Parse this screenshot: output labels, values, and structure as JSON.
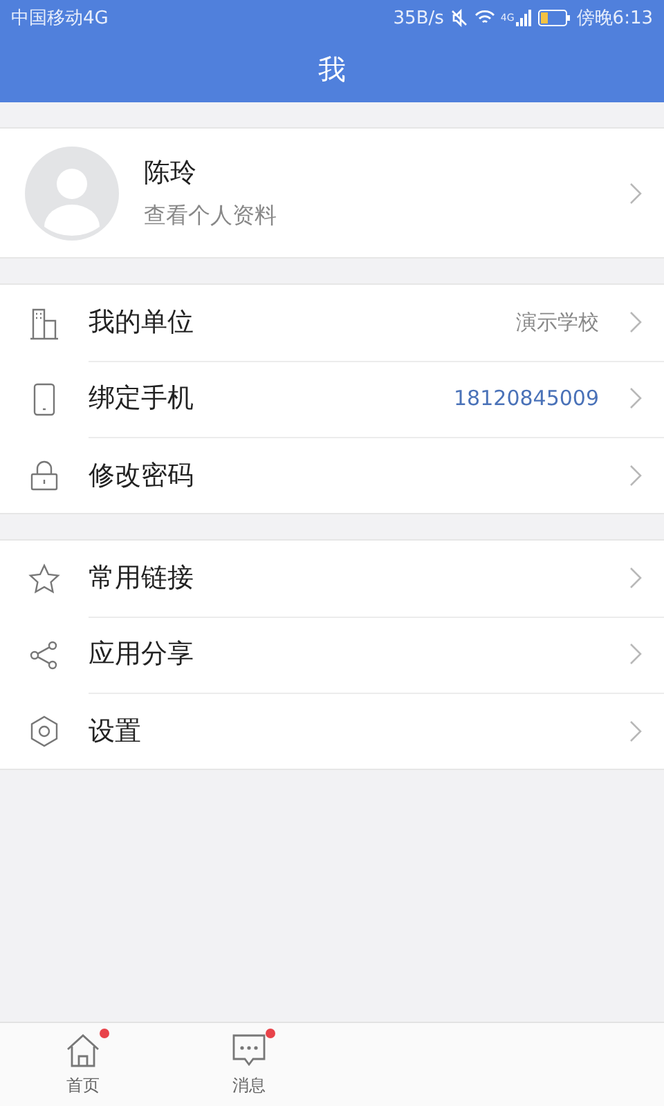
{
  "status_bar": {
    "carrier": "中国移动4G",
    "speed": "35B/s",
    "network": "4G",
    "time": "傍晚6:13"
  },
  "header": {
    "title": "我"
  },
  "profile": {
    "name": "陈玲",
    "subtitle": "查看个人资料"
  },
  "groups": [
    {
      "items": [
        {
          "label": "我的单位",
          "value": "演示学校",
          "kind": "plain"
        },
        {
          "label": "绑定手机",
          "value": "18120845009",
          "kind": "link"
        },
        {
          "label": "修改密码"
        }
      ]
    },
    {
      "items": [
        {
          "label": "常用链接"
        },
        {
          "label": "应用分享"
        },
        {
          "label": "设置"
        }
      ]
    }
  ],
  "bottom_nav": [
    {
      "label": "首页",
      "badge": true
    },
    {
      "label": "消息",
      "badge": true
    }
  ]
}
